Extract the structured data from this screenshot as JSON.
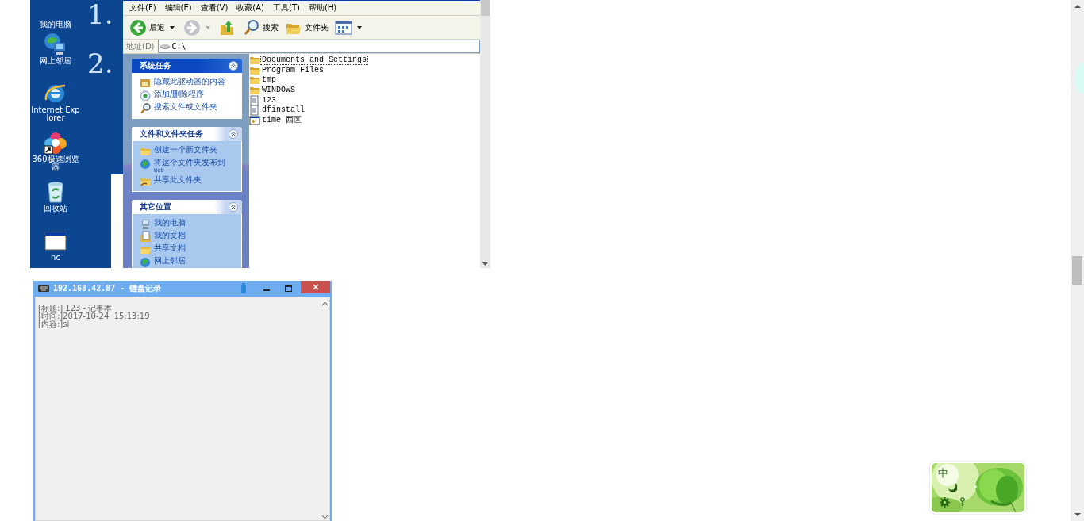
{
  "desktop_screenshot": {
    "desktop_icons": [
      {
        "label": "我的电脑",
        "kind": "computer"
      },
      {
        "label": "网上邻居",
        "kind": "network"
      },
      {
        "label": "Internet Explorer",
        "kind": "ie"
      },
      {
        "label": "360极速浏览器",
        "kind": "browser"
      },
      {
        "label": "回收站",
        "kind": "recycle"
      },
      {
        "label": "nc",
        "kind": "window"
      }
    ],
    "wallpaper_lines": [
      "1.",
      "2."
    ],
    "explorer": {
      "menu": [
        "文件(F)",
        "编辑(E)",
        "查看(V)",
        "收藏(A)",
        "工具(T)",
        "帮助(H)"
      ],
      "toolbar": [
        {
          "kind": "back",
          "label": "后退"
        },
        {
          "kind": "forward"
        },
        {
          "kind": "up"
        },
        {
          "kind": "search",
          "label": "搜索"
        },
        {
          "kind": "folders",
          "label": "文件夹"
        },
        {
          "kind": "views"
        }
      ],
      "address": {
        "label": "地址(D)",
        "value": "C:\\"
      },
      "task_panels": [
        {
          "title": "系统任务",
          "kind": "primary",
          "links": [
            {
              "label": "隐藏此驱动器的内容",
              "kind": "hide"
            },
            {
              "label": "添加/删除程序",
              "kind": "install"
            },
            {
              "label": "搜索文件或文件夹",
              "kind": "search"
            }
          ]
        },
        {
          "title": "文件和文件夹任务",
          "kind": "normal",
          "links": [
            {
              "label": "创建一个新文件夹",
              "kind": "folder"
            },
            {
              "label": "将这个文件夹发布到",
              "sub": "Web",
              "kind": "globe"
            },
            {
              "label": "共享此文件夹",
              "kind": "share"
            }
          ]
        },
        {
          "title": "其它位置",
          "kind": "normal",
          "links": [
            {
              "label": "我的电脑",
              "kind": "computer"
            },
            {
              "label": "我的文档",
              "kind": "docs"
            },
            {
              "label": "共享文档",
              "kind": "folder"
            },
            {
              "label": "网上邻居",
              "kind": "globe"
            }
          ]
        }
      ],
      "files": [
        {
          "name": "Documents and Settings",
          "kind": "folder",
          "selected": true
        },
        {
          "name": "Program Files",
          "kind": "folder",
          "selected": false
        },
        {
          "name": "tmp",
          "kind": "folder",
          "selected": false
        },
        {
          "name": "WINDOWS",
          "kind": "folder",
          "selected": false
        },
        {
          "name": "123",
          "kind": "text",
          "selected": false
        },
        {
          "name": "dfinstall",
          "kind": "text",
          "selected": false
        },
        {
          "name": "time 西区",
          "kind": "app",
          "selected": false
        }
      ]
    }
  },
  "keylog_window": {
    "title": "192.168.42.87 - 键盘记录",
    "lines": [
      "[标题:] 123 - 记事本",
      "[时间:]2017-10-24  15:13:19",
      "[内容:]si"
    ]
  },
  "ime_widget": {
    "label": "中"
  }
}
